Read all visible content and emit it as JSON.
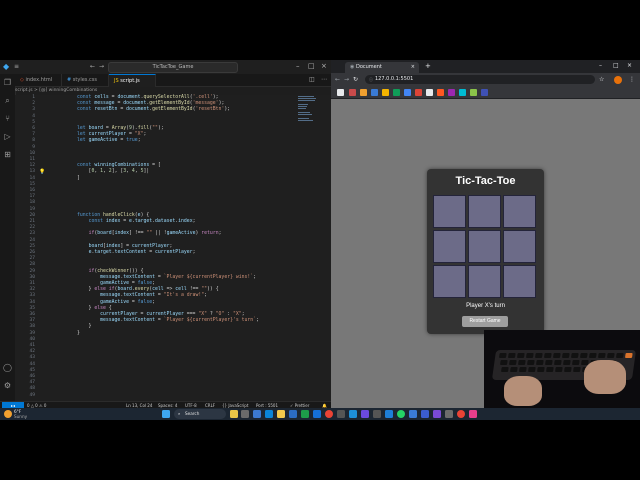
{
  "vscode": {
    "search_text": "TicTacToe_Game",
    "tabs": [
      "index.html",
      "styles.css",
      "script.js"
    ],
    "breadcrumb": "script.js > [@] winningCombinations",
    "line_numbers": [
      "1",
      "2",
      "3",
      "4",
      "5",
      "6",
      "7",
      "8",
      "9",
      "10",
      "11",
      "12",
      "13",
      "14",
      "15",
      "16",
      "17",
      "18",
      "19",
      "20",
      "21",
      "22",
      "23",
      "24",
      "25",
      "26",
      "27",
      "28",
      "29",
      "30",
      "31",
      "32",
      "33",
      "34",
      "35",
      "36",
      "37",
      "38",
      "39",
      "40",
      "41",
      "42",
      "43",
      "44",
      "45",
      "46",
      "47",
      "48",
      "49"
    ],
    "status": {
      "left": "0 △ 0   ⚠ 0",
      "position": "Ln 13, Col 24",
      "spaces": "Spaces: 4",
      "encoding": "UTF-8",
      "eol": "CRLF",
      "language": "{} JavaScript",
      "port": "Port : 5501",
      "prettier": "✓ Prettier"
    }
  },
  "browser": {
    "tab_title": "Document",
    "url": "127.0.0.1:5501",
    "game": {
      "title": "Tic-Tac-Toe",
      "cells": [
        "",
        "",
        "",
        "",
        "",
        "",
        "",
        "",
        ""
      ],
      "message": "Player X's turn",
      "restart_label": "Restart Game"
    }
  },
  "taskbar": {
    "weather_temp": "6°F",
    "weather_desc": "Sunny",
    "search_label": "Search"
  },
  "colors": {
    "game_bg": "#333333",
    "cell_bg": "#6c6b88",
    "page_bg": "#787878",
    "accent": "#0078d4"
  }
}
